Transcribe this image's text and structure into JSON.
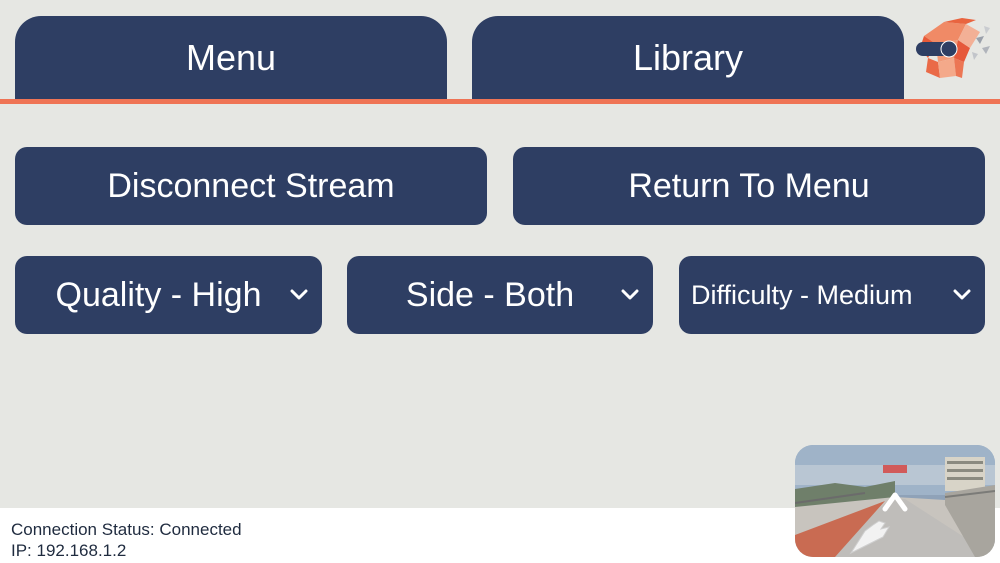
{
  "tabs": {
    "menu_label": "Menu",
    "library_label": "Library"
  },
  "actions": {
    "disconnect_label": "Disconnect Stream",
    "return_label": "Return To Menu"
  },
  "dropdowns": {
    "quality": "Quality - High",
    "side": "Side - Both",
    "difficulty": "Difficulty - Medium"
  },
  "status": {
    "connection": "Connection Status: Connected",
    "ip": "IP: 192.168.1.2"
  },
  "colors": {
    "button": "#2e3e63",
    "accent": "#ef7455",
    "background": "#e6e7e3"
  },
  "icons": {
    "logo": "brain-logo-icon",
    "chevron": "chevron-down-icon",
    "preview_arrow": "up-arrow-icon",
    "preview_hand": "hand-icon"
  }
}
